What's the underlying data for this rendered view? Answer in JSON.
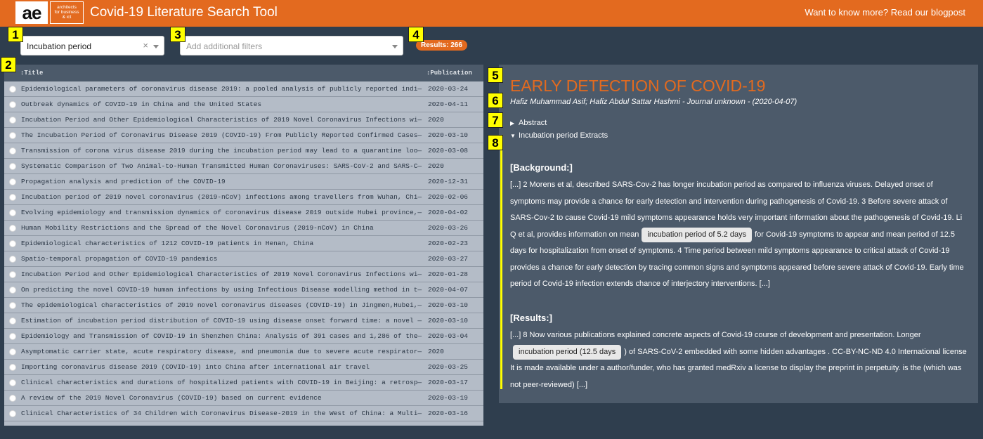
{
  "header": {
    "logo_text": "ae",
    "logo_tagline": [
      "architects",
      "for business",
      "& ict"
    ],
    "title": "Covid-19 Literature Search Tool",
    "blog_link": "Want to know more? Read our blogpost"
  },
  "badges": [
    "1",
    "2",
    "3",
    "4",
    "5",
    "6",
    "7",
    "8"
  ],
  "filters": {
    "primary_value": "Incubation period",
    "clear_symbol": "×",
    "additional_placeholder": "Add additional filters"
  },
  "results_label": "Results: 266",
  "table": {
    "columns": [
      "↕Title",
      "↕Publication"
    ],
    "rows": [
      {
        "title": "Epidemiological parameters of coronavirus disease 2019: a pooled analysis of publicly reported indi—",
        "date": "2020-03-24"
      },
      {
        "title": "Outbreak dynamics of COVID-19 in China and the United States",
        "date": "2020-04-11"
      },
      {
        "title": "Incubation Period and Other Epidemiological Characteristics of 2019 Novel Coronavirus Infections wi—",
        "date": "2020"
      },
      {
        "title": "The Incubation Period of Coronavirus Disease 2019 (COVID-19) From Publicly Reported Confirmed Cases—",
        "date": "2020-03-10"
      },
      {
        "title": "Transmission of corona virus disease 2019 during the incubation period may lead to a quarantine loo—",
        "date": "2020-03-08"
      },
      {
        "title": "Systematic Comparison of Two Animal-to-Human Transmitted Human Coronaviruses: SARS-CoV-2 and SARS-C—",
        "date": "2020"
      },
      {
        "title": "Propagation analysis and prediction of the COVID-19",
        "date": "2020-12-31"
      },
      {
        "title": "Incubation period of 2019 novel coronavirus (2019-nCoV) infections among travellers from Wuhan, Chi—",
        "date": "2020-02-06"
      },
      {
        "title": "Evolving epidemiology and transmission dynamics of coronavirus disease 2019 outside Hubei province,—",
        "date": "2020-04-02"
      },
      {
        "title": "Human Mobility Restrictions and the Spread of the Novel Coronavirus (2019-nCoV) in China",
        "date": "2020-03-26"
      },
      {
        "title": "Epidemiological characteristics of 1212 COVID-19 patients in Henan, China",
        "date": "2020-02-23"
      },
      {
        "title": "Spatio-temporal propagation of COVID-19 pandemics",
        "date": "2020-03-27"
      },
      {
        "title": "Incubation Period and Other Epidemiological Characteristics of 2019 Novel Coronavirus Infections wi—",
        "date": "2020-01-28"
      },
      {
        "title": "On predicting the novel COVID-19 human infections by using Infectious Disease modelling method in t—",
        "date": "2020-04-07"
      },
      {
        "title": "The epidemiological characteristics of 2019 novel coronavirus diseases (COVID-19) in Jingmen,Hubei,—",
        "date": "2020-03-10"
      },
      {
        "title": "Estimation of incubation period distribution of COVID-19 using disease onset forward time: a novel —",
        "date": "2020-03-10"
      },
      {
        "title": "Epidemiology and Transmission of COVID-19 in Shenzhen China: Analysis of 391 cases and 1,286 of the—",
        "date": "2020-03-04"
      },
      {
        "title": "Asymptomatic carrier state, acute respiratory disease, and pneumonia due to severe acute respirator—",
        "date": "2020"
      },
      {
        "title": "Importing coronavirus disease 2019 (COVID-19) into China after international air travel",
        "date": "2020-03-25"
      },
      {
        "title": "Clinical characteristics and durations of hospitalized patients with COVID-19 in Beijing: a retrosp—",
        "date": "2020-03-17"
      },
      {
        "title": "A review of the 2019 Novel Coronavirus (COVID-19) based on current evidence",
        "date": "2020-03-19"
      },
      {
        "title": "Clinical Characteristics of 34 Children with Coronavirus Disease-2019 in the West of China: a Multi—",
        "date": "2020-03-16"
      }
    ]
  },
  "detail": {
    "title": "EARLY DETECTION OF COVID-19",
    "authors": "Hafiz Muhammad Asif; Hafiz Abdul Sattar Hashmi - Journal unknown - (2020-04-07)",
    "abstract_toggle": "Abstract",
    "abstract_arrow": "▶",
    "extracts_toggle": "Incubation period Extracts",
    "extracts_arrow": "▼",
    "background_heading": "[Background:]",
    "background_pre": "[...] 2 Morens et al, described SARS-Cov-2 has longer incubation period as compared to influenza viruses. Delayed onset of symptoms may provide a chance for early detection and intervention during pathogenesis of Covid-19. 3 Before severe attack of SARS-Cov-2 to cause Covid-19 mild symptoms appearance holds very important information about the pathogenesis of Covid-19. Li Q et al, provides information on mean",
    "background_highlight": "incubation period of 5.2 days",
    "background_post": "for Covid-19 symptoms to appear and mean period of 12.5 days for hospitalization from onset of symptoms. 4 Time period between mild symptoms appearance to critical attack of Covid-19 provides a chance for early detection by tracing common signs and symptoms appeared before severe attack of Covid-19. Early time period of Covid-19 infection extends chance of interjectory interventions. [...]",
    "results_heading": "[Results:]",
    "results_pre": "[...] 8 Now various publications explained concrete aspects of Covid-19 course of development and presentation. Longer",
    "results_highlight": "incubation period (12.5 days",
    "results_post": ") of SARS-CoV-2 embedded with some hidden advantages . CC-BY-NC-ND 4.0 International license It is made available under a author/funder, who has granted medRxiv a license to display the preprint in perpetuity. is the (which was not peer-reviewed) [...]"
  }
}
